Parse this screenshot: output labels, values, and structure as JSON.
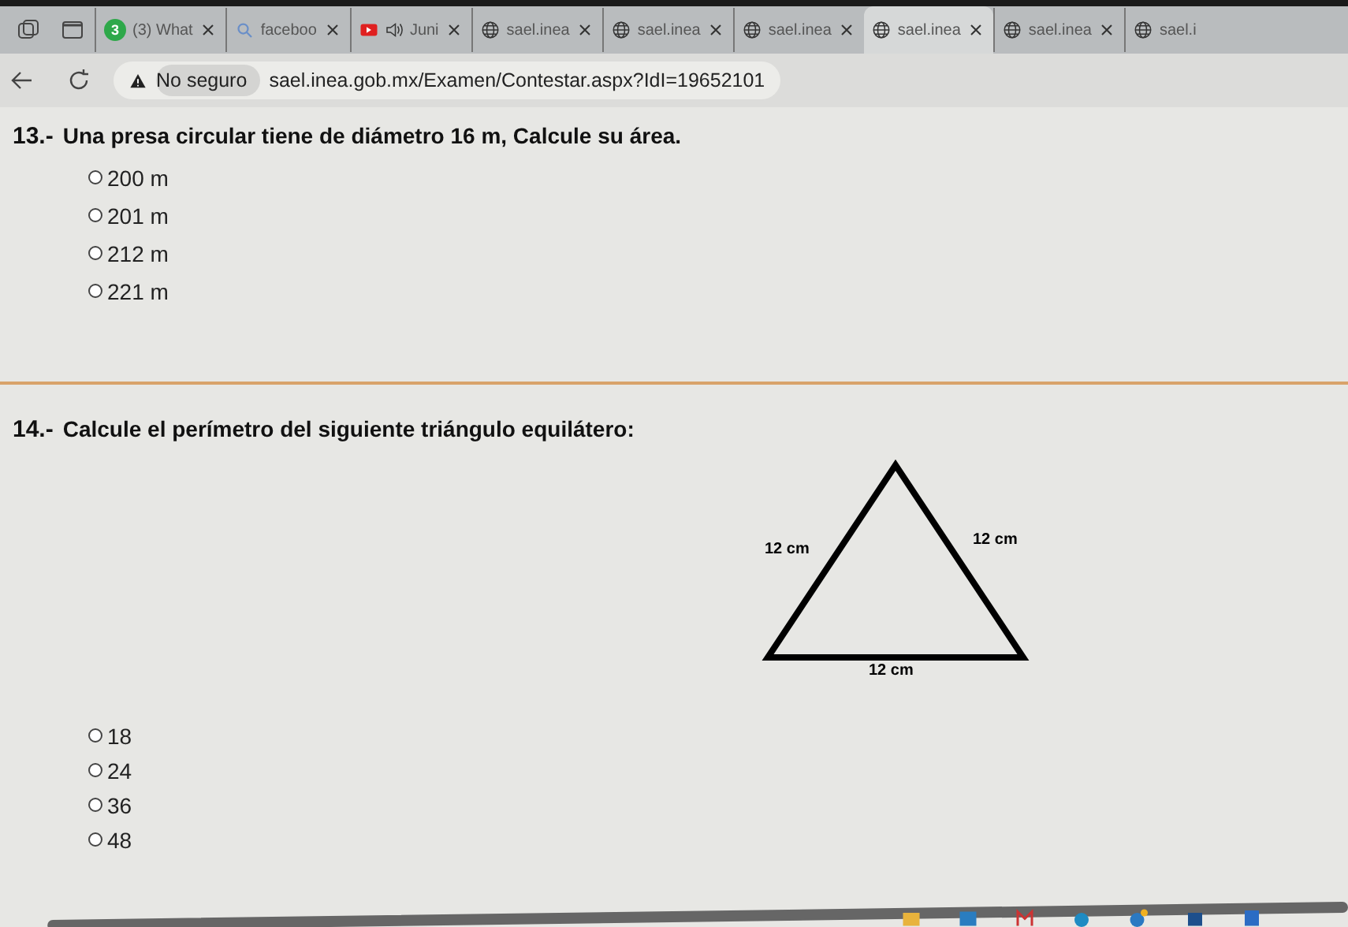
{
  "tabs": [
    {
      "kind": "whatsapp",
      "badge": "3",
      "label": "(3) What",
      "selected": false,
      "audio": false,
      "closable": true
    },
    {
      "kind": "search",
      "label": "faceboo",
      "selected": false,
      "audio": false,
      "closable": true
    },
    {
      "kind": "youtube",
      "label": "Juni",
      "selected": false,
      "audio": true,
      "closable": true
    },
    {
      "kind": "web",
      "label": "sael.inea",
      "selected": false,
      "audio": false,
      "closable": true
    },
    {
      "kind": "web",
      "label": "sael.inea",
      "selected": false,
      "audio": false,
      "closable": true
    },
    {
      "kind": "web",
      "label": "sael.inea",
      "selected": false,
      "audio": false,
      "closable": true
    },
    {
      "kind": "web",
      "label": "sael.inea",
      "selected": true,
      "audio": false,
      "closable": true
    },
    {
      "kind": "web",
      "label": "sael.inea",
      "selected": false,
      "audio": false,
      "closable": true
    },
    {
      "kind": "web",
      "label": "sael.i",
      "selected": false,
      "audio": false,
      "closable": false
    }
  ],
  "address_bar": {
    "security": "No seguro",
    "url": "sael.inea.gob.mx/Examen/Contestar.aspx?IdI=19652101"
  },
  "questions": [
    {
      "number": "13.-",
      "text": "Una presa circular tiene de diámetro 16 m, Calcule su área.",
      "options": [
        {
          "label": "200 m",
          "selected": false
        },
        {
          "label": "201 m",
          "selected": false
        },
        {
          "label": "212 m",
          "selected": false
        },
        {
          "label": "221 m",
          "selected": false
        }
      ]
    },
    {
      "number": "14.-",
      "text": "Calcule el perímetro del siguiente triángulo equilátero:",
      "figure": {
        "left_label": "12 cm",
        "right_label": "12 cm",
        "bottom_label": "12 cm"
      },
      "options": [
        {
          "label": "18",
          "selected": false
        },
        {
          "label": "24",
          "selected": false
        },
        {
          "label": "36",
          "selected": false
        },
        {
          "label": "48",
          "selected": false
        }
      ]
    }
  ]
}
